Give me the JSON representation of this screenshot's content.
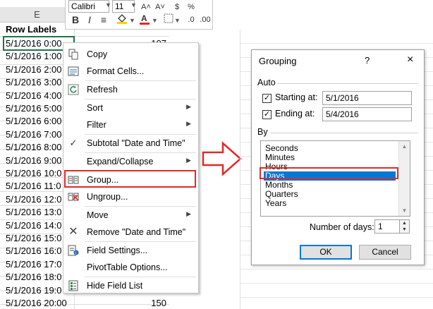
{
  "sheet": {
    "column_letter": "E",
    "row_labels_header": "Row Labels",
    "rows": [
      {
        "label": "5/1/2016 0:00",
        "value": "107"
      },
      {
        "label": "5/1/2016 1:00",
        "value": ""
      },
      {
        "label": "5/1/2016 2:00",
        "value": ""
      },
      {
        "label": "5/1/2016 3:00",
        "value": ""
      },
      {
        "label": "5/1/2016 4:00",
        "value": ""
      },
      {
        "label": "5/1/2016 5:00",
        "value": ""
      },
      {
        "label": "5/1/2016 6:00",
        "value": ""
      },
      {
        "label": "5/1/2016 7:00",
        "value": ""
      },
      {
        "label": "5/1/2016 8:00",
        "value": ""
      },
      {
        "label": "5/1/2016 9:00",
        "value": ""
      },
      {
        "label": "5/1/2016 10:0",
        "value": ""
      },
      {
        "label": "5/1/2016 11:0",
        "value": ""
      },
      {
        "label": "5/1/2016 12:0",
        "value": ""
      },
      {
        "label": "5/1/2016 13:0",
        "value": ""
      },
      {
        "label": "5/1/2016 14:0",
        "value": ""
      },
      {
        "label": "5/1/2016 15:0",
        "value": ""
      },
      {
        "label": "5/1/2016 16:0",
        "value": ""
      },
      {
        "label": "5/1/2016 17:0",
        "value": ""
      },
      {
        "label": "5/1/2016 18:0",
        "value": ""
      },
      {
        "label": "5/1/2016 19:0",
        "value": ""
      },
      {
        "label": "5/1/2016 20:00",
        "value": "150"
      }
    ]
  },
  "mini_toolbar": {
    "font_name": "Calibri",
    "font_size": "11",
    "font_color": "#e02a2a"
  },
  "context_menu": {
    "items": [
      {
        "label": "Copy",
        "icon": "copy-icon"
      },
      {
        "label": "Format Cells...",
        "icon": "format-cells-icon"
      },
      {
        "label": "Refresh",
        "icon": "refresh-icon"
      },
      {
        "label": "Sort",
        "icon": "",
        "submenu": "▶"
      },
      {
        "label": "Filter",
        "icon": "",
        "submenu": "▶"
      },
      {
        "label": "Subtotal \"Date and Time\"",
        "icon": "check-icon"
      },
      {
        "label": "Expand/Collapse",
        "icon": "",
        "submenu": "▶"
      },
      {
        "label": "Group...",
        "icon": "group-icon"
      },
      {
        "label": "Ungroup...",
        "icon": "ungroup-icon"
      },
      {
        "label": "Move",
        "icon": "",
        "submenu": "▶"
      },
      {
        "label": "Remove \"Date and Time\"",
        "icon": "remove-icon"
      },
      {
        "label": "Field Settings...",
        "icon": "field-settings-icon"
      },
      {
        "label": "PivotTable Options...",
        "icon": ""
      },
      {
        "label": "Hide Field List",
        "icon": "field-list-icon"
      }
    ]
  },
  "dialog": {
    "title": "Grouping",
    "help": "?",
    "close": "×",
    "auto_section": "Auto",
    "starting_label": "Starting at:",
    "starting_value": "5/1/2016",
    "starting_checked": true,
    "ending_label": "Ending at:",
    "ending_value": "5/4/2016",
    "ending_checked": true,
    "by_section": "By",
    "by_items": [
      "Seconds",
      "Minutes",
      "Hours",
      "Days",
      "Months",
      "Quarters",
      "Years"
    ],
    "selected_item": "Days",
    "number_of_days_label": "Number of days:",
    "number_of_days_value": "1",
    "ok_label": "OK",
    "cancel_label": "Cancel"
  },
  "colors": {
    "highlight_red": "#e02a2a",
    "selection_blue": "#0078d7",
    "excel_green": "#217346"
  }
}
